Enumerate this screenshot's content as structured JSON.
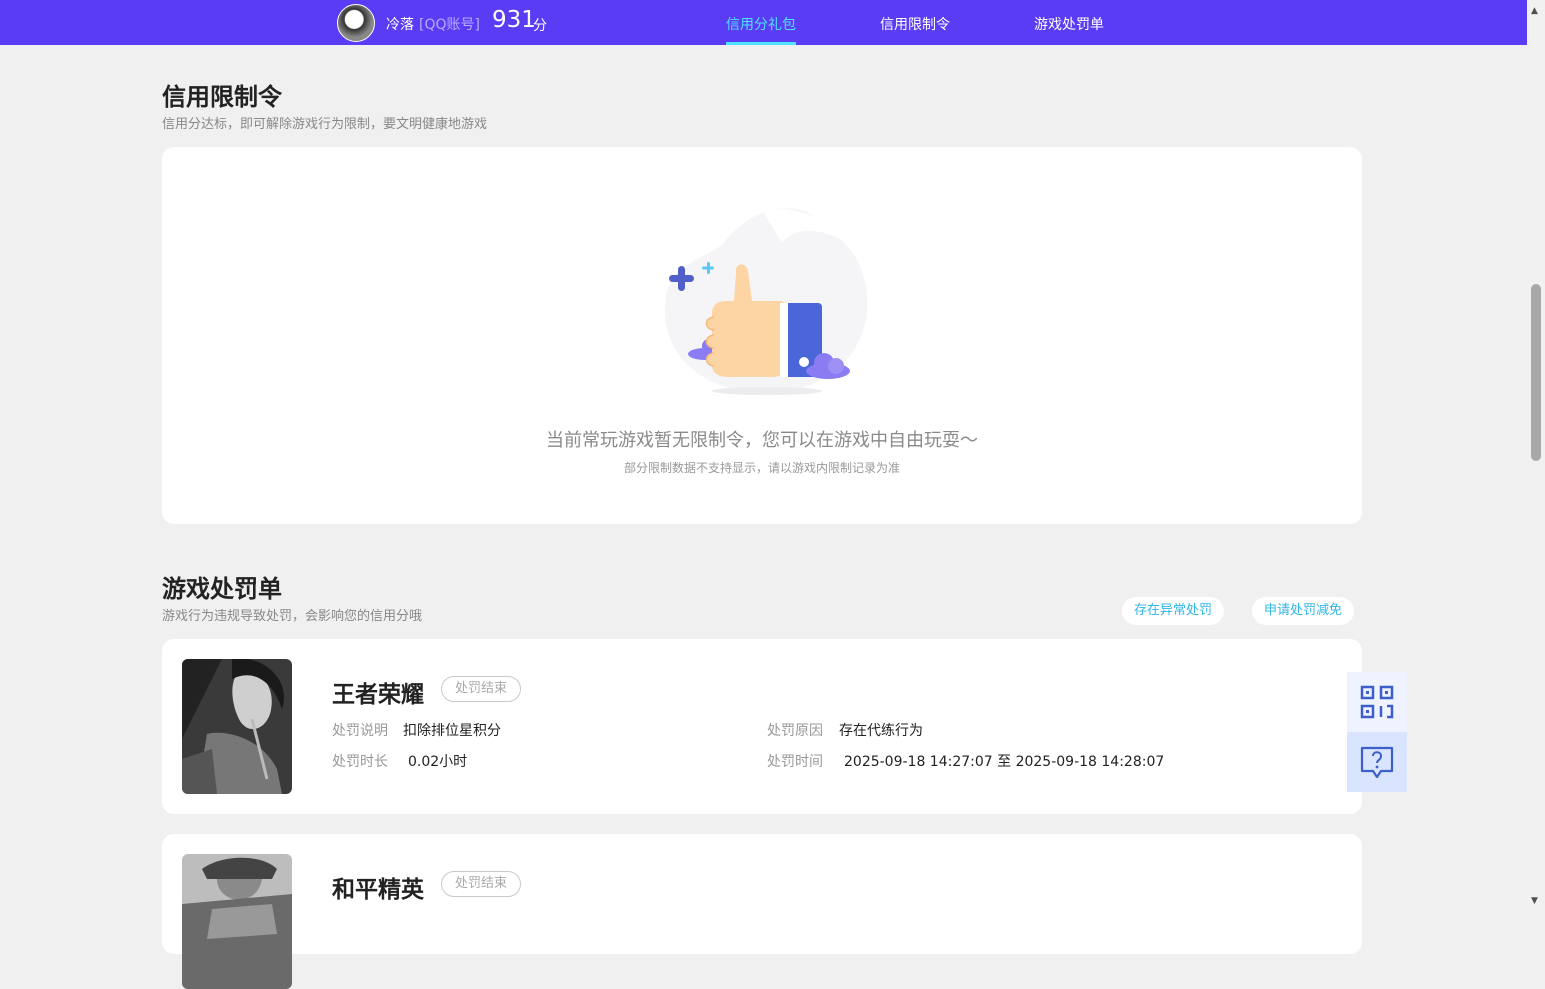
{
  "header": {
    "nickname": "冷落",
    "account_type": "[QQ账号]",
    "score": "931",
    "score_unit": "分",
    "nav": [
      {
        "label": "信用分礼包",
        "active": true
      },
      {
        "label": "信用限制令",
        "active": false
      },
      {
        "label": "游戏处罚单",
        "active": false
      }
    ]
  },
  "restriction": {
    "title": "信用限制令",
    "subtitle": "信用分达标，即可解除游戏行为限制，要文明健康地游戏",
    "empty_message": "当前常玩游戏暂无限制令，您可以在游戏中自由玩耍～",
    "empty_note": "部分限制数据不支持显示，请以游戏内限制记录为准"
  },
  "penalty": {
    "title": "游戏处罚单",
    "subtitle": "游戏行为违规导致处罚，会影响您的信用分哦",
    "actions": {
      "abnormal": "存在异常处罚",
      "reduce": "申请处罚减免"
    },
    "labels": {
      "desc": "处罚说明",
      "reason": "处罚原因",
      "duration": "处罚时长",
      "time": "处罚时间"
    },
    "items": [
      {
        "game": "王者荣耀",
        "status": "处罚结束",
        "desc": "扣除排位星积分",
        "reason": "存在代练行为",
        "duration": "0.02小时",
        "time": "2025-09-18 14:27:07 至 2025-09-18 14:28:07"
      },
      {
        "game": "和平精英",
        "status": "处罚结束"
      }
    ]
  },
  "colors": {
    "header_bg": "#5a3cf5",
    "nav_active": "#4fe3ff",
    "link": "#2fb6e8",
    "side_tool_bg": "#e3ecff",
    "side_tool_icon": "#3d5fc9"
  },
  "icons": [
    "qr-code-icon",
    "help-chat-icon",
    "thumbs-up-illustration"
  ]
}
